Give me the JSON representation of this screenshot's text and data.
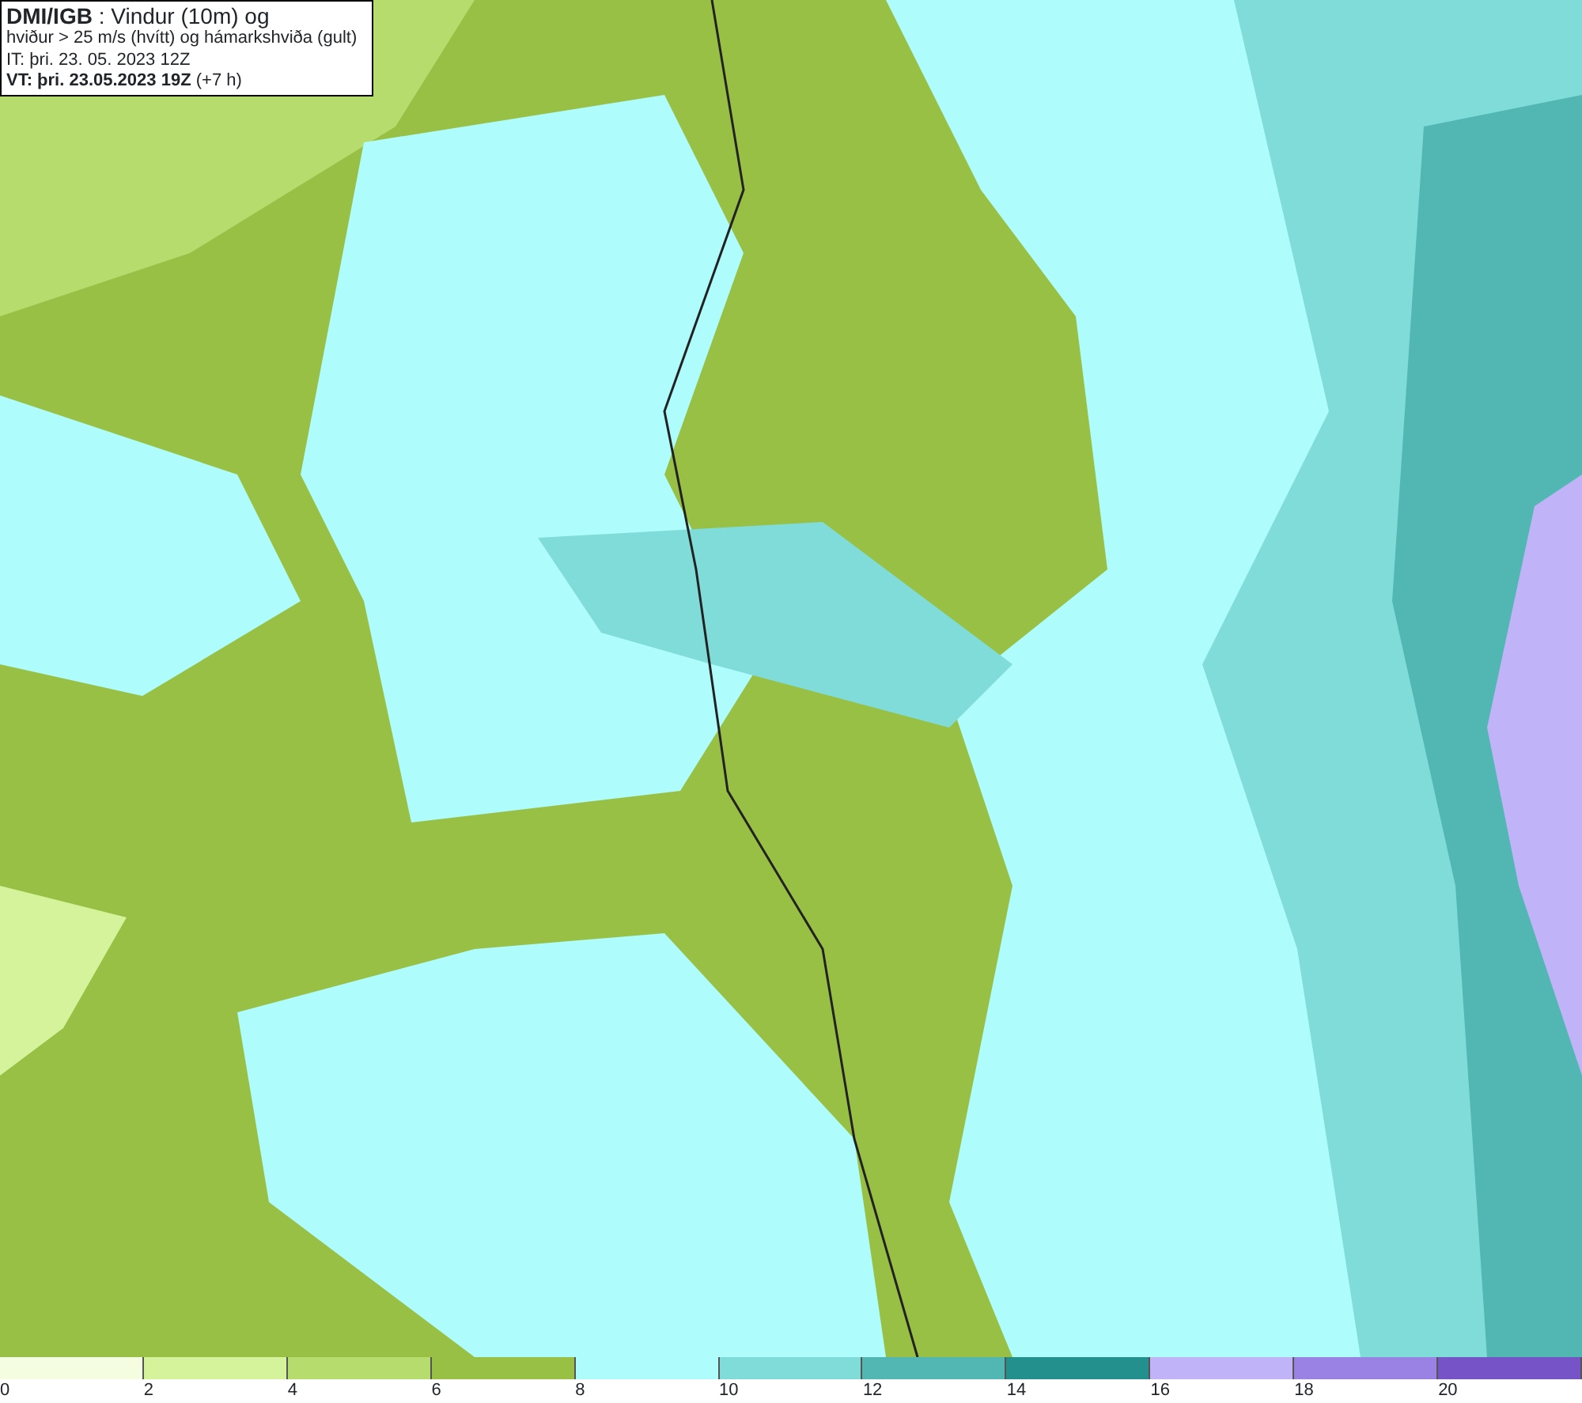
{
  "header": {
    "lines": [
      "**DMI/IGB** : Vindur (10m) og",
      "hviður > 25 m/s (hvítt) og hámarkshviða (gult)",
      "IT: þri. 23. 05. 2023 12Z",
      "**VT: þri. 23.05.2023 19Z** (+7 h)"
    ]
  },
  "legend": [
    {
      "label": "0",
      "color": "#f4fde0"
    },
    {
      "label": "2",
      "color": "#d4f39a"
    },
    {
      "label": "4",
      "color": "#b5dc6c"
    },
    {
      "label": "6",
      "color": "#98c044"
    },
    {
      "label": "8",
      "color": "#aefcfc"
    },
    {
      "label": "10",
      "color": "#7fdcd8"
    },
    {
      "label": "12",
      "color": "#52b7b3"
    },
    {
      "label": "14",
      "color": "#23908e"
    },
    {
      "label": "16",
      "color": "#c0b3f8"
    },
    {
      "label": "18",
      "color": "#9a82e4"
    },
    {
      "label": "20",
      "color": "#7654c8"
    }
  ]
}
